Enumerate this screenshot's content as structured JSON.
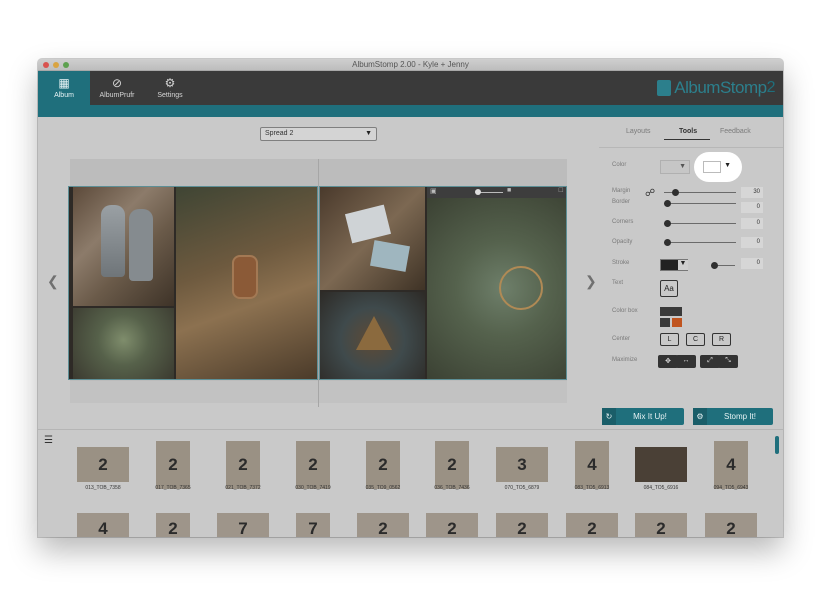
{
  "window": {
    "title": "AlbumStomp 2.00 - Kyle + Jenny"
  },
  "toolbar": {
    "buttons": [
      {
        "label": "Album",
        "icon": "album-icon"
      },
      {
        "label": "AlbumPrufr",
        "icon": "compass-icon"
      },
      {
        "label": "Settings",
        "icon": "gear-icon"
      }
    ],
    "logo": {
      "text": "AlbumStomp",
      "suffix": "2"
    }
  },
  "spread_select": {
    "value": "Spread 2"
  },
  "tabs": [
    "Layouts",
    "Tools",
    "Feedback"
  ],
  "tools": {
    "labels": {
      "color": "Color",
      "margin": "Margin",
      "border": "Border",
      "corners": "Corners",
      "opacity": "Opacity",
      "stroke": "Stroke",
      "text": "Text",
      "color_box": "Color box",
      "center": "Center",
      "maximize": "Maximize"
    },
    "margin_value": "30",
    "border_value": "0",
    "corners_value": "0",
    "opacity_value": "0",
    "stroke_value": "0",
    "text_button": "Aa",
    "center_buttons": [
      "L",
      "C",
      "R"
    ],
    "margin_fraction": 0.12,
    "border_fraction": 0.0,
    "corners_fraction": 0.0,
    "opacity_fraction": 0.0,
    "stroke_fraction": 0.0,
    "colors": {
      "stroke": "#222222",
      "colorbox_dark": "#3a3a3a",
      "colorbox_accent": "#c0541f",
      "accent": "#1f6f7c"
    }
  },
  "actions": {
    "mix": "Mix It Up!",
    "stomp": "Stomp It!"
  },
  "thumbnails": [
    {
      "count": "2",
      "name": "013_TOB_7358"
    },
    {
      "count": "2",
      "name": "017_TOB_7365"
    },
    {
      "count": "2",
      "name": "021_TOB_7372"
    },
    {
      "count": "2",
      "name": "030_TOB_7419"
    },
    {
      "count": "2",
      "name": "035_TO9_0562"
    },
    {
      "count": "2",
      "name": "036_TOB_7436"
    },
    {
      "count": "3",
      "name": "070_TO5_6879"
    },
    {
      "count": "4",
      "name": "083_TO5_6913"
    },
    {
      "count": "",
      "name": "084_TO5_6916"
    },
    {
      "count": "4",
      "name": "094_TO5_6943"
    }
  ],
  "thumbnails_row2": [
    "4",
    "2",
    "7",
    "7",
    "2",
    "2",
    "2",
    "2",
    "2",
    "2"
  ]
}
